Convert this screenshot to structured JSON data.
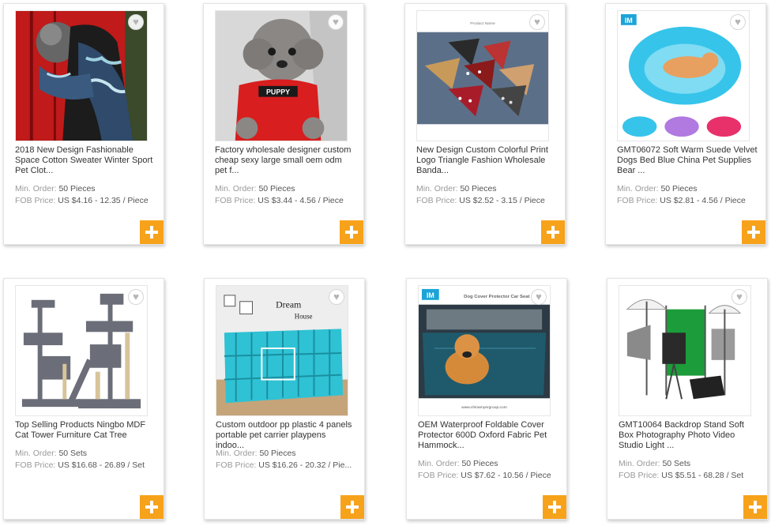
{
  "labels": {
    "min_order": "Min. Order:",
    "fob_price": "FOB Price:"
  },
  "products": [
    {
      "title": "2018 New Design Fashionable Space Cotton Sweater Winter Sport Pet Clot...",
      "min_order": "50 Pieces",
      "price": "US $4.16 - 12.35 / Piece"
    },
    {
      "title": "Factory wholesale designer custom cheap sexy large small oem odm pet f...",
      "min_order": "50 Pieces",
      "price": "US $3.44 - 4.56 / Piece"
    },
    {
      "title": "New Design Custom Colorful Print Logo Triangle Fashion Wholesale Banda...",
      "min_order": "50 Pieces",
      "price": "US $2.52 - 3.15 / Piece"
    },
    {
      "title": "GMT06072 Soft Warm Suede Velvet Dogs Bed Blue China Pet Supplies Bear ...",
      "min_order": "50 Pieces",
      "price": "US $2.81 - 4.56 / Piece"
    },
    {
      "title": "Top Selling Products Ningbo MDF Cat Tower Furniture Cat Tree",
      "min_order": "50 Sets",
      "price": "US $16.68 - 26.89 / Set"
    },
    {
      "title": "Custom outdoor pp plastic 4 panels portable pet carrier playpens indoo...",
      "min_order": "50 Pieces",
      "price": "US $16.26 - 20.32 / Pie..."
    },
    {
      "title": "OEM Waterproof Foldable Cover Protector 600D Oxford Fabric Pet Hammock...",
      "min_order": "50 Pieces",
      "price": "US $7.62 - 10.56 / Piece"
    },
    {
      "title": "GMT10064 Backdrop Stand Soft Box Photography Photo Video Studio Light ...",
      "min_order": "50 Sets",
      "price": "US $5.51 - 68.28 / Set"
    }
  ],
  "image_text": {
    "dog_shirt": "PUPPY",
    "bandana_header": "Product Name",
    "bed_logo": "IM",
    "dream_sign": "Dream",
    "house_sign": "House",
    "car_logo": "IM",
    "car_header": "Dog Cover Protector Car Seat",
    "car_footer": "www.chinamyergroup.com"
  },
  "colors": {
    "add_button": "#f7a21b",
    "heart": "#b5b5b5"
  },
  "icons": {
    "favorite": "heart-icon",
    "add": "plus-icon"
  }
}
